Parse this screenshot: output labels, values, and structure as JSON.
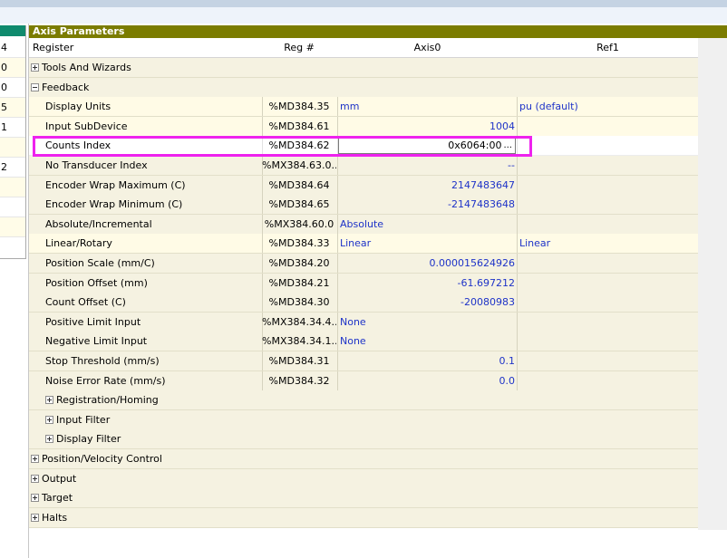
{
  "left_panel": {
    "rows": [
      {
        "text": "4"
      },
      {
        "text": "0"
      },
      {
        "text": "0"
      },
      {
        "text": "5"
      },
      {
        "text": "1"
      },
      {
        "text": ""
      },
      {
        "text": "2"
      },
      {
        "text": ""
      },
      {
        "text": ""
      },
      {
        "text": ""
      }
    ]
  },
  "panel": {
    "title": "Axis Parameters",
    "columns": {
      "register": "Register",
      "regnum": "Reg #",
      "axis0": "Axis0",
      "ref1": "Ref1"
    }
  },
  "rows": [
    {
      "label": "Tools And Wizards",
      "expander": "plus",
      "indent": 0
    },
    {
      "label": "Feedback",
      "expander": "minus",
      "indent": 0
    },
    {
      "label": "Display Units",
      "regnum": "%MD384.35",
      "axis0": "mm",
      "ref1": "pu (default)",
      "indent": 1
    },
    {
      "label": "Input SubDevice",
      "regnum": "%MD384.61",
      "axis0": "1004",
      "indent": 1
    },
    {
      "label": "Counts Index",
      "regnum": "%MD384.62",
      "axis0": "0x6064:00",
      "editing": true,
      "indent": 1
    },
    {
      "label": "No Transducer Index",
      "regnum": "%MX384.63.0...",
      "axis0": "--",
      "indent": 1
    },
    {
      "label": "Encoder Wrap Maximum (C)",
      "regnum": "%MD384.64",
      "axis0": "2147483647",
      "indent": 1
    },
    {
      "label": "Encoder Wrap Minimum (C)",
      "regnum": "%MD384.65",
      "axis0": "-2147483648",
      "indent": 1
    },
    {
      "label": "Absolute/Incremental",
      "regnum": "%MX384.60.0",
      "axis0": "Absolute",
      "indent": 1
    },
    {
      "label": "Linear/Rotary",
      "regnum": "%MD384.33",
      "axis0": "Linear",
      "ref1": "Linear",
      "indent": 1
    },
    {
      "label": "Position Scale (mm/C)",
      "regnum": "%MD384.20",
      "axis0": "0.000015624926",
      "indent": 1
    },
    {
      "label": "Position Offset (mm)",
      "regnum": "%MD384.21",
      "axis0": "-61.697212",
      "indent": 1
    },
    {
      "label": "Count Offset (C)",
      "regnum": "%MD384.30",
      "axis0": "-20080983",
      "indent": 1
    },
    {
      "label": "Positive Limit Input",
      "regnum": "%MX384.34.4...",
      "axis0": "None",
      "indent": 1
    },
    {
      "label": "Negative Limit Input",
      "regnum": "%MX384.34.1...",
      "axis0": "None",
      "indent": 1
    },
    {
      "label": "Stop Threshold (mm/s)",
      "regnum": "%MD384.31",
      "axis0": "0.1",
      "indent": 1
    },
    {
      "label": "Noise Error Rate (mm/s)",
      "regnum": "%MD384.32",
      "axis0": "0.0",
      "indent": 1
    },
    {
      "label": "Registration/Homing",
      "expander": "plus",
      "indent": 1
    },
    {
      "label": "Input Filter",
      "expander": "plus",
      "indent": 1
    },
    {
      "label": "Display Filter",
      "expander": "plus",
      "indent": 1
    },
    {
      "label": "Position/Velocity Control",
      "expander": "plus",
      "indent": 0
    },
    {
      "label": "Output",
      "expander": "plus",
      "indent": 0
    },
    {
      "label": "Target",
      "expander": "plus",
      "indent": 0
    },
    {
      "label": "Halts",
      "expander": "plus",
      "indent": 0
    }
  ],
  "colors": {
    "title_bar": "#7b7c00",
    "highlight": "#ee22ee",
    "value_blue": "#1e33c8",
    "left_header": "#0f8a6d"
  }
}
